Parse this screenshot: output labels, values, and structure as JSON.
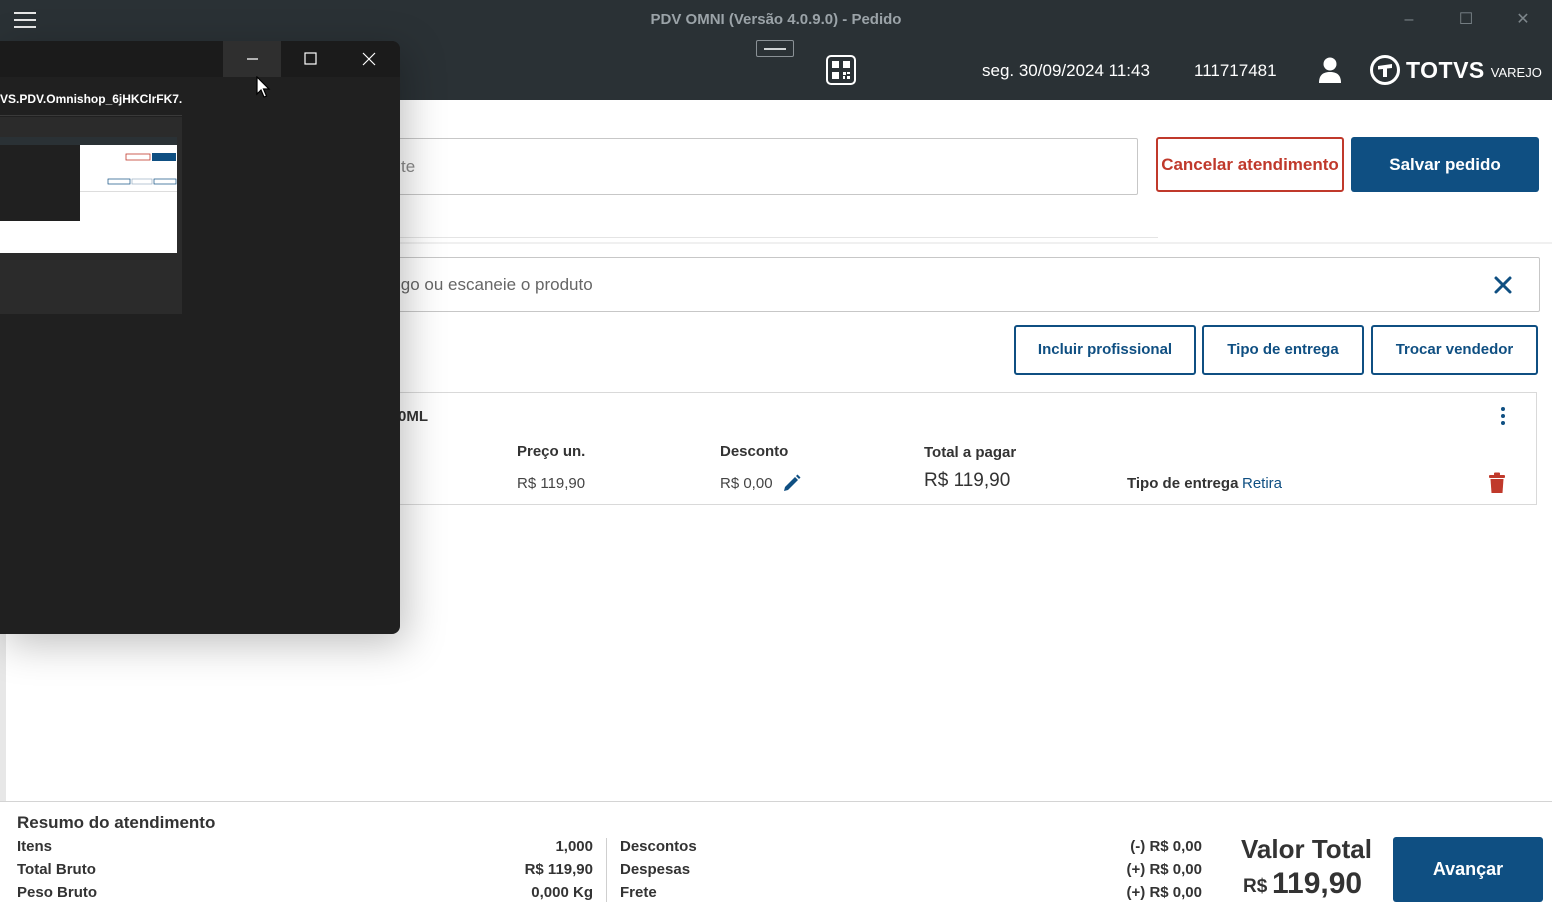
{
  "window": {
    "title": "PDV OMNI (Versão 4.0.9.0) - Pedido",
    "controls": [
      "–",
      "☐",
      "✕"
    ]
  },
  "header": {
    "datetime": "seg. 30/09/2024 11:43",
    "operator_id": "111717481",
    "logo_main": "TOTVS",
    "logo_sub": "VAREJO"
  },
  "client": {
    "input_value": "te",
    "cancel_label": "Cancelar atendimento",
    "save_label": "Salvar pedido"
  },
  "product_search": {
    "value": "igo ou escaneie o produto"
  },
  "actions": {
    "include_professional": "Incluir profissional",
    "delivery_type": "Tipo de entrega",
    "change_seller": "Trocar vendedor"
  },
  "item": {
    "name": "0ML",
    "unit_price_label": "Preço un.",
    "unit_price": "R$ 119,90",
    "discount_label": "Desconto",
    "discount": "R$ 0,00",
    "total_label": "Total a pagar",
    "total": "R$ 119,90",
    "delivery_label": "Tipo de entrega",
    "delivery_value": "Retira"
  },
  "popup": {
    "caption": "VS.PDV.Omnishop_6jHKClrFK7...."
  },
  "summary": {
    "title": "Resumo do atendimento",
    "items_label": "Itens",
    "items_value": "1,000",
    "gross_total_label": "Total Bruto",
    "gross_total_value": "R$ 119,90",
    "gross_weight_label": "Peso Bruto",
    "gross_weight_value": "0,000 Kg",
    "discounts_label": "Descontos",
    "discounts_value": "(-) R$ 0,00",
    "expenses_label": "Despesas",
    "expenses_value": "(+) R$ 0,00",
    "freight_label": "Frete",
    "freight_value": "(+) R$ 0,00",
    "total_label": "Valor Total",
    "total_currency": "R$",
    "total_value": "119,90",
    "next_label": "Avançar"
  },
  "colors": {
    "primary": "#0f4f82",
    "danger": "#c0392b",
    "header_bg": "#2a3135",
    "popup_bg": "#202020"
  },
  "icons": [
    "hamburger-icon",
    "qr-code-icon",
    "user-icon",
    "totvs-logo-icon",
    "close-icon",
    "kebab-menu-icon",
    "pencil-icon",
    "trash-icon",
    "cursor-icon"
  ]
}
